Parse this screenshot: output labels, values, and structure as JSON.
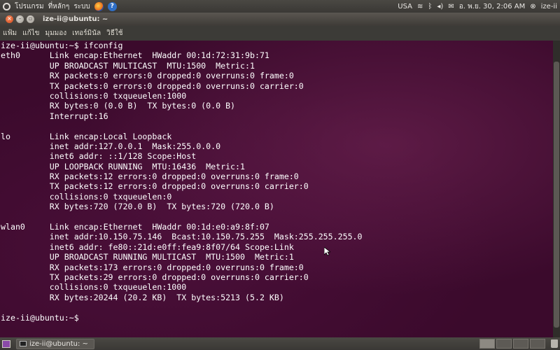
{
  "top_panel": {
    "menus": [
      "โปรแกรม",
      "ที่หลักๆ",
      "ระบบ"
    ],
    "keyboard_layout": "USA",
    "clock": "อ. พ.ย. 30,  2:06 AM",
    "user": "ize-ii"
  },
  "window": {
    "title": "ize-ii@ubuntu: ~"
  },
  "menubar": {
    "items": [
      "แฟ้ม",
      "แก้ไข",
      "มุมมอง",
      "เทอร์มินัล",
      "วิธีใช้"
    ]
  },
  "terminal": {
    "lines": [
      "ize-ii@ubuntu:~$ ifconfig",
      "eth0      Link encap:Ethernet  HWaddr 00:1d:72:31:9b:71",
      "          UP BROADCAST MULTICAST  MTU:1500  Metric:1",
      "          RX packets:0 errors:0 dropped:0 overruns:0 frame:0",
      "          TX packets:0 errors:0 dropped:0 overruns:0 carrier:0",
      "          collisions:0 txqueuelen:1000",
      "          RX bytes:0 (0.0 B)  TX bytes:0 (0.0 B)",
      "          Interrupt:16",
      "",
      "lo        Link encap:Local Loopback",
      "          inet addr:127.0.0.1  Mask:255.0.0.0",
      "          inet6 addr: ::1/128 Scope:Host",
      "          UP LOOPBACK RUNNING  MTU:16436  Metric:1",
      "          RX packets:12 errors:0 dropped:0 overruns:0 frame:0",
      "          TX packets:12 errors:0 dropped:0 overruns:0 carrier:0",
      "          collisions:0 txqueuelen:0",
      "          RX bytes:720 (720.0 B)  TX bytes:720 (720.0 B)",
      "",
      "wlan0     Link encap:Ethernet  HWaddr 00:1d:e0:a9:8f:07",
      "          inet addr:10.150.75.146  Bcast:10.150.75.255  Mask:255.255.255.0",
      "          inet6 addr: fe80::21d:e0ff:fea9:8f07/64 Scope:Link",
      "          UP BROADCAST RUNNING MULTICAST  MTU:1500  Metric:1",
      "          RX packets:173 errors:0 dropped:0 overruns:0 frame:0",
      "          TX packets:29 errors:0 dropped:0 overruns:0 carrier:0",
      "          collisions:0 txqueuelen:1000",
      "          RX bytes:20244 (20.2 KB)  TX bytes:5213 (5.2 KB)",
      "",
      "ize-ii@ubuntu:~$"
    ]
  },
  "taskbar": {
    "task_label": "ize-ii@ubuntu: ~"
  },
  "icons": {
    "system_logo": "ubuntu-logo-icon",
    "browser": "firefox-icon",
    "help": "help-icon",
    "network": "wifi-icon",
    "bluetooth": "bluetooth-icon",
    "volume": "volume-icon",
    "mail": "mail-icon",
    "session": "power-icon"
  }
}
